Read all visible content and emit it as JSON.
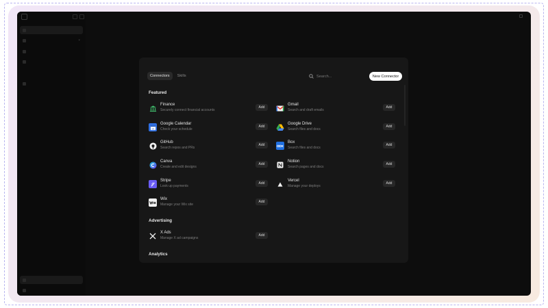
{
  "modal": {
    "tabs": [
      {
        "label": "Connectors",
        "active": true
      },
      {
        "label": "Skills",
        "active": false
      }
    ],
    "search_placeholder": "Search...",
    "new_connector_label": "New Connector",
    "add_label": "Add"
  },
  "sections": {
    "featured": "Featured",
    "advertising": "Advertising",
    "analytics": "Analytics"
  },
  "connectors": {
    "finance": {
      "name": "Finance",
      "desc": "Securely connect financial accounts",
      "icon": "bank-icon"
    },
    "gmail": {
      "name": "Gmail",
      "desc": "Search and draft emails",
      "icon": "gmail-icon"
    },
    "gcal": {
      "name": "Google Calendar",
      "desc": "Check your schedule",
      "icon": "calendar-icon"
    },
    "gdrive": {
      "name": "Google Drive",
      "desc": "Search files and docs",
      "icon": "drive-icon"
    },
    "github": {
      "name": "GitHub",
      "desc": "Search repos and PRs",
      "icon": "github-icon"
    },
    "box": {
      "name": "Box",
      "desc": "Search files and docs",
      "icon": "box-icon"
    },
    "canva": {
      "name": "Canva",
      "desc": "Create and edit designs",
      "icon": "canva-icon"
    },
    "notion": {
      "name": "Notion",
      "desc": "Search pages and docs",
      "icon": "notion-icon"
    },
    "stripe": {
      "name": "Stripe",
      "desc": "Look up payments",
      "icon": "stripe-icon"
    },
    "vercel": {
      "name": "Vercel",
      "desc": "Manage your deploys",
      "icon": "vercel-icon"
    },
    "wix": {
      "name": "Wix",
      "desc": "Manage your Wix site",
      "icon": "wix-icon"
    },
    "xads": {
      "name": "X Ads",
      "desc": "Manage X ad campaigns",
      "icon": "x-icon"
    }
  },
  "colors": {
    "app_bg": "#0d0d0d",
    "modal_bg": "#171717",
    "accent_white": "#ffffff",
    "frame_dash": "#b7b4ef"
  }
}
